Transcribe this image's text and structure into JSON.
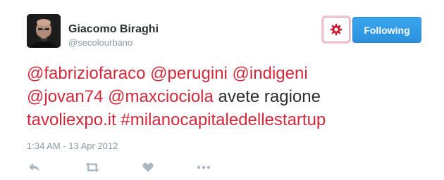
{
  "user": {
    "display_name": "Giacomo Biraghi",
    "handle": "@secolourbano"
  },
  "header": {
    "follow_label": "Following",
    "settings_icon": "gear-icon"
  },
  "tweet": {
    "segments": [
      {
        "text": "@fabriziofaraco",
        "type": "mention"
      },
      {
        "text": " ",
        "type": "text"
      },
      {
        "text": "@perugini",
        "type": "mention"
      },
      {
        "text": " ",
        "type": "text"
      },
      {
        "text": "@indigeni",
        "type": "mention"
      },
      {
        "text": " ",
        "type": "text"
      },
      {
        "text": "@jovan74",
        "type": "mention"
      },
      {
        "text": " ",
        "type": "text"
      },
      {
        "text": "@maxciociola",
        "type": "mention"
      },
      {
        "text": " avete ragione ",
        "type": "text"
      },
      {
        "text": "tavoliexpo.it",
        "type": "url"
      },
      {
        "text": " ",
        "type": "text"
      },
      {
        "text": "#milanocapitaledellestartup",
        "type": "hashtag"
      }
    ],
    "timestamp": "1:34 AM - 13 Apr 2012"
  },
  "actions": [
    {
      "name": "reply",
      "icon": "reply-icon"
    },
    {
      "name": "retweet",
      "icon": "retweet-icon"
    },
    {
      "name": "like",
      "icon": "heart-icon"
    },
    {
      "name": "more",
      "icon": "more-icon"
    }
  ],
  "colors": {
    "link": "#d2283a",
    "follow_button": "#2b91dd",
    "muted": "#8899a6",
    "text": "#292f33"
  }
}
